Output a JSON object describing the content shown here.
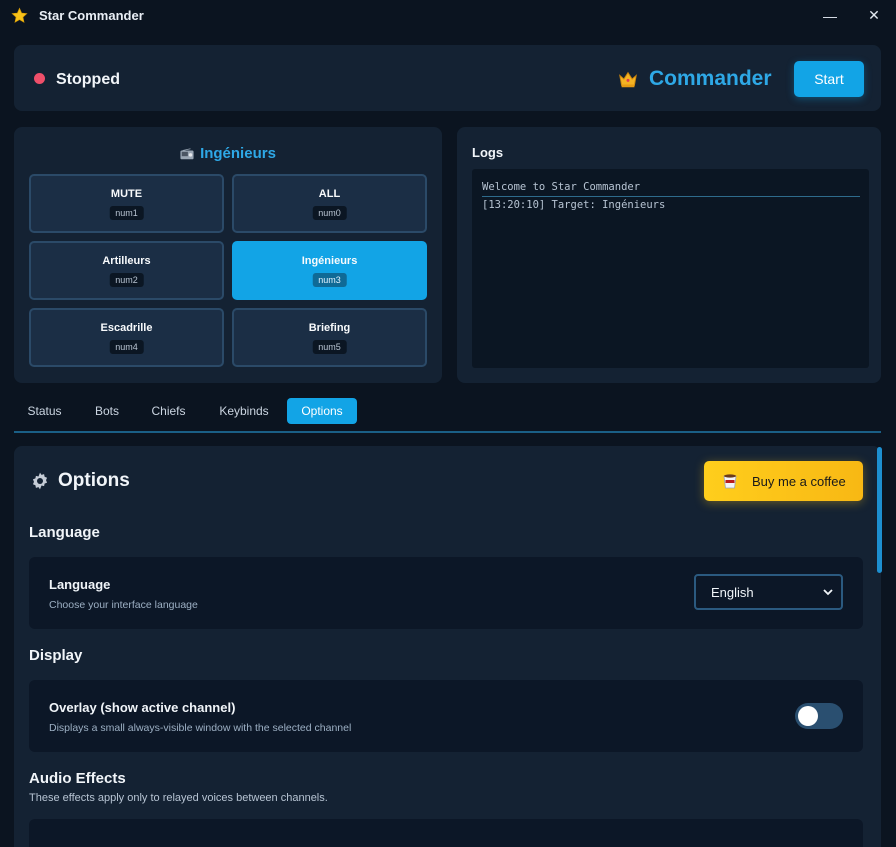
{
  "window": {
    "title": "Star Commander",
    "minimize_glyph": "—",
    "close_glyph": "✕"
  },
  "status": {
    "state": "Stopped",
    "brand": "Commander",
    "start_label": "Start",
    "dot_color": "#ef4f6a"
  },
  "channels": {
    "title": "Ingénieurs",
    "items": [
      {
        "label": "MUTE",
        "key": "num1",
        "active": false
      },
      {
        "label": "ALL",
        "key": "num0",
        "active": false
      },
      {
        "label": "Artilleurs",
        "key": "num2",
        "active": false
      },
      {
        "label": "Ingénieurs",
        "key": "num3",
        "active": true
      },
      {
        "label": "Escadrille",
        "key": "num4",
        "active": false
      },
      {
        "label": "Briefing",
        "key": "num5",
        "active": false
      }
    ]
  },
  "logs": {
    "title": "Logs",
    "welcome": "Welcome to Star Commander",
    "entries": [
      "[13:20:10] Target: Ingénieurs"
    ]
  },
  "tabs": [
    {
      "label": "Status",
      "active": false
    },
    {
      "label": "Bots",
      "active": false
    },
    {
      "label": "Chiefs",
      "active": false
    },
    {
      "label": "Keybinds",
      "active": false
    },
    {
      "label": "Options",
      "active": true
    }
  ],
  "options": {
    "title": "Options",
    "coffee_label": "Buy me a coffee",
    "language_section": "Language",
    "language": {
      "title": "Language",
      "description": "Choose your interface language",
      "value": "English"
    },
    "display_section": "Display",
    "overlay": {
      "title": "Overlay (show active channel)",
      "description": "Displays a small always-visible window with the selected channel",
      "enabled": false
    },
    "audio_section": "Audio Effects",
    "audio_description": "These effects apply only to relayed voices between channels."
  },
  "colors": {
    "accent": "#12a4e6",
    "brand": "#2ea8e6",
    "coffee": "#ffc61a",
    "background": "#0b1420",
    "panel": "#142233"
  },
  "icons": {
    "app": "star-icon",
    "brand": "crown-icon",
    "channels": "radio-icon",
    "options": "gear-icon",
    "coffee": "coffee-cup-icon",
    "select": "chevron-down-icon"
  }
}
